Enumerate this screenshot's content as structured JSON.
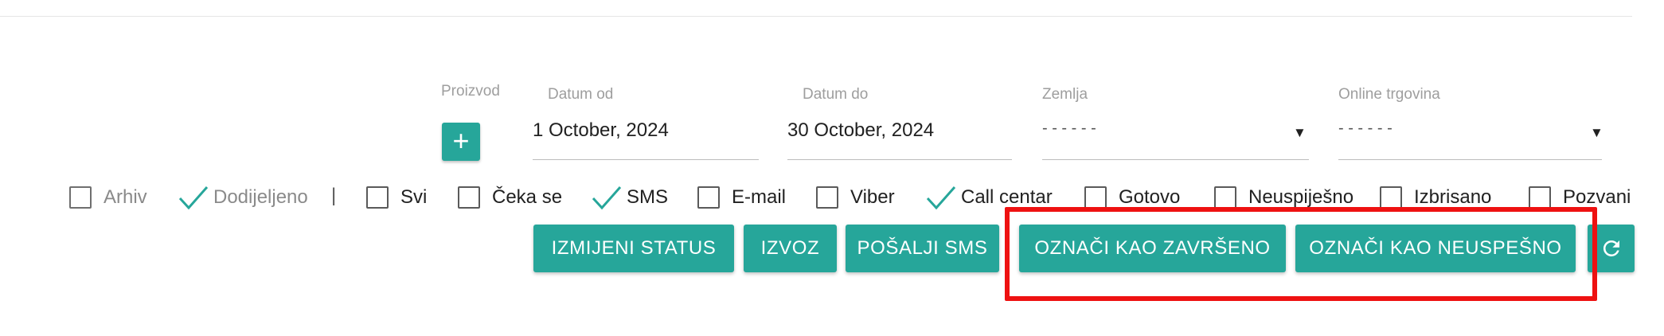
{
  "filters": {
    "product": {
      "label": "Proizvod",
      "add_icon": "+"
    },
    "date_from": {
      "label": "Datum od",
      "value": "1 October, 2024"
    },
    "date_to": {
      "label": "Datum do",
      "value": "30 October, 2024"
    },
    "country": {
      "label": "Zemlja",
      "value": "- - - - - -",
      "arrow": "▼"
    },
    "online_store": {
      "label": "Online trgovina",
      "value": "- - - - - -",
      "arrow": "▼"
    }
  },
  "checkboxes": [
    {
      "label": "Arhiv",
      "checked": false,
      "disabled": true
    },
    {
      "label": "Dodijeljeno",
      "checked": true,
      "disabled": true
    },
    {
      "label": "Svi",
      "checked": false
    },
    {
      "label": "Čeka se",
      "checked": false
    },
    {
      "label": "SMS",
      "checked": true
    },
    {
      "label": "E-mail",
      "checked": false
    },
    {
      "label": "Viber",
      "checked": false
    },
    {
      "label": "Call centar",
      "checked": true
    },
    {
      "label": "Gotovo",
      "checked": false
    },
    {
      "label": "Neuspiješno",
      "checked": false
    },
    {
      "label": "Izbrisano",
      "checked": false
    },
    {
      "label": "Pozvani",
      "checked": false
    }
  ],
  "separator": "|",
  "actions": {
    "change_status": "IZMIJENI STATUS",
    "export": "IZVOZ",
    "send_sms": "POŠALJI SMS",
    "mark_done": "OZNAČI KAO ZAVRŠENO",
    "mark_failed": "OZNAČI KAO NEUSPEŠNO",
    "refresh_icon": "refresh-icon"
  },
  "colors": {
    "accent": "#26a69a",
    "highlight": "#ee1111"
  }
}
